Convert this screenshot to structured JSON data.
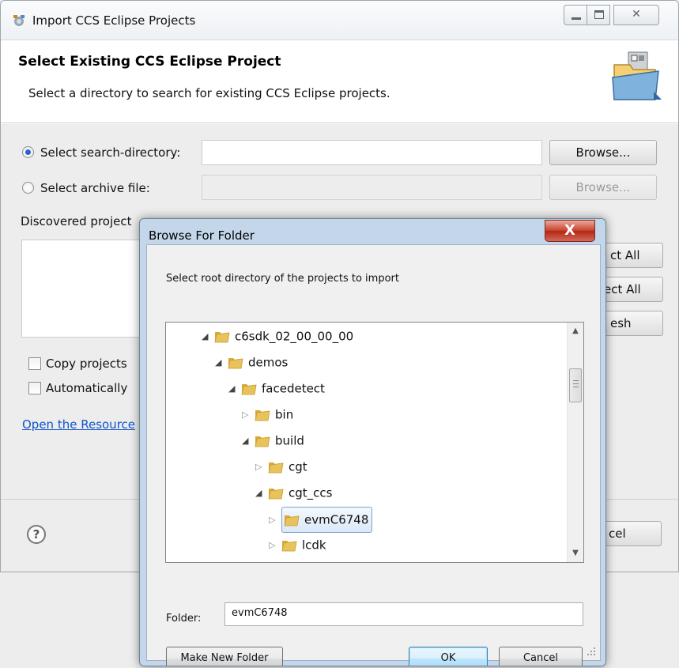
{
  "window": {
    "title": "Import CCS Eclipse Projects"
  },
  "header": {
    "title": "Select Existing CCS Eclipse Project",
    "subtitle": "Select a directory to search for existing CCS Eclipse projects."
  },
  "source": {
    "search_dir_label": "Select search-directory:",
    "search_dir_value": "",
    "archive_label": "Select archive file:",
    "archive_value": "",
    "browse_label": "Browse...",
    "browse_disabled_label": "Browse...",
    "selected_option": "search-directory"
  },
  "projects": {
    "label": "Discovered project",
    "select_all_fragment": "ct All",
    "deselect_all_fragment": "ect All",
    "refresh_fragment": "esh"
  },
  "options": {
    "copy_label": "Copy projects",
    "auto_label": "Automatically",
    "copy_checked": false,
    "auto_checked": false
  },
  "link": {
    "text": "Open the Resource"
  },
  "footer": {
    "help_symbol": "?",
    "cancel_fragment": "cel"
  },
  "dialog": {
    "title": "Browse For Folder",
    "close_symbol": "X",
    "message": "Select root directory of the projects to import",
    "tree": [
      {
        "name": "c6sdk_02_00_00_00",
        "level": 0,
        "expanded": true,
        "selected": false
      },
      {
        "name": "demos",
        "level": 1,
        "expanded": true,
        "selected": false
      },
      {
        "name": "facedetect",
        "level": 2,
        "expanded": true,
        "selected": false
      },
      {
        "name": "bin",
        "level": 3,
        "expanded": false,
        "selected": false
      },
      {
        "name": "build",
        "level": 3,
        "expanded": true,
        "selected": false
      },
      {
        "name": "cgt",
        "level": 4,
        "expanded": false,
        "selected": false
      },
      {
        "name": "cgt_ccs",
        "level": 4,
        "expanded": true,
        "selected": false
      },
      {
        "name": "evmC6748",
        "level": 5,
        "expanded": false,
        "selected": true
      },
      {
        "name": "lcdk",
        "level": 5,
        "expanded": false,
        "selected": false
      }
    ],
    "folder_label": "Folder:",
    "folder_value": "evmC6748",
    "make_new_folder_label": "Make New Folder",
    "ok_label": "OK",
    "cancel_label": "Cancel"
  },
  "colors": {
    "accent": "#2b62c9",
    "link": "#1155cc",
    "folder": "#e8c25a",
    "close_red": "#c9452f"
  }
}
